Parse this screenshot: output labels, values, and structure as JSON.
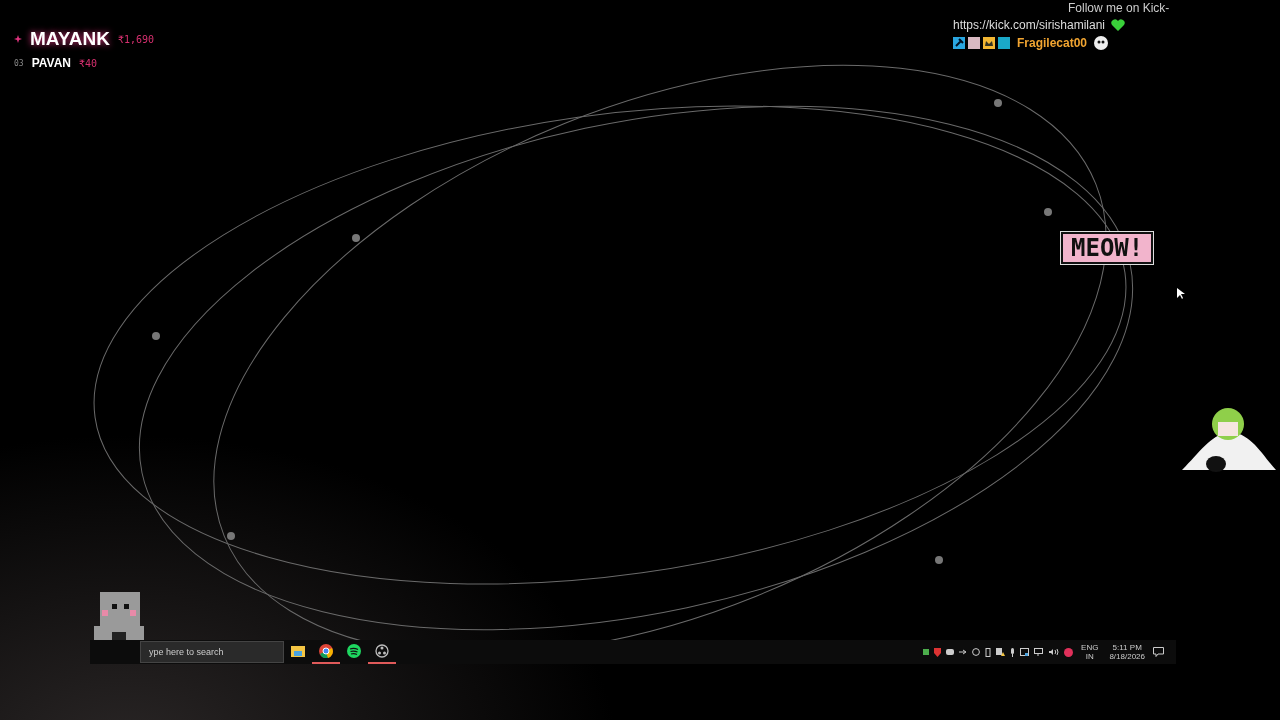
{
  "leaderboard": [
    {
      "kind": "top",
      "name": "MAYANK",
      "amount": "₹1,690"
    },
    {
      "kind": "ranked",
      "rank": "03",
      "name": "PAVAN",
      "amount": "₹40"
    }
  ],
  "chat": {
    "message": "Follow me on Kick-",
    "link": "https://kick.com/sirishamilani",
    "username": "Fragilecat00"
  },
  "speech_bubble": {
    "text": "MEOW!"
  },
  "taskbar": {
    "search": {
      "placeholder": "ype here to search"
    },
    "apps": [
      {
        "kind": "folder",
        "running": false
      },
      {
        "kind": "browser",
        "running": true
      },
      {
        "kind": "music",
        "running": false
      },
      {
        "kind": "recorder",
        "running": true
      }
    ],
    "language": "ENG",
    "region": "IN",
    "time": "5:11 PM",
    "date": "8/18/2026"
  }
}
